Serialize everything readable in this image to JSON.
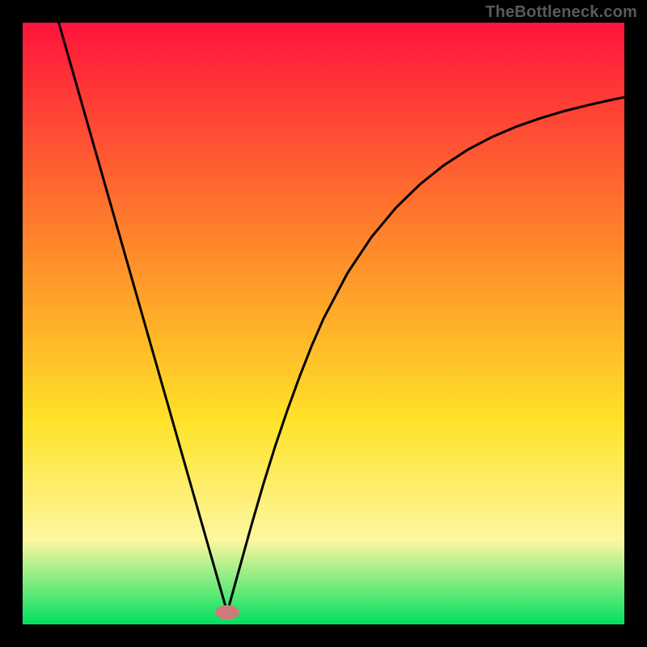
{
  "watermark": "TheBottleneck.com",
  "colors": {
    "frame": "#000000",
    "gradient_top": "#ff143c",
    "gradient_mid1": "#ff8a2a",
    "gradient_mid2": "#ffe228",
    "gradient_mid3": "#fdf7a0",
    "gradient_bottom": "#00e060",
    "curve": "#000000",
    "marker": "#cf7a77"
  },
  "chart_data": {
    "type": "line",
    "title": "",
    "xlabel": "",
    "ylabel": "",
    "xlim": [
      0,
      100
    ],
    "ylim": [
      0,
      100
    ],
    "minimum_x": 34,
    "marker": {
      "x": 34,
      "y": 2,
      "rx": 2.0,
      "ry": 1.2
    },
    "note": "V-shaped bottleneck curve; values are percentage of horizontal/vertical extent of the plot area. y=0 is the bottom (green), y=100 is the top (red).",
    "series": [
      {
        "name": "bottleneck-curve",
        "x": [
          6,
          8,
          10,
          12,
          14,
          16,
          18,
          20,
          22,
          24,
          26,
          28,
          30,
          31,
          32,
          33,
          34,
          35,
          36,
          37,
          38,
          40,
          42,
          44,
          46,
          48,
          50,
          54,
          58,
          62,
          66,
          70,
          74,
          78,
          82,
          86,
          90,
          94,
          98,
          100
        ],
        "y": [
          100,
          93,
          86,
          79,
          72,
          65,
          58,
          51,
          44,
          37,
          30,
          23,
          16,
          12.5,
          9,
          5.5,
          2,
          5.6,
          9.2,
          12.8,
          16.4,
          23.3,
          29.7,
          35.6,
          41.1,
          46.2,
          50.8,
          58.4,
          64.4,
          69.2,
          73.1,
          76.3,
          78.9,
          81.0,
          82.7,
          84.1,
          85.3,
          86.3,
          87.2,
          87.6
        ]
      }
    ]
  }
}
